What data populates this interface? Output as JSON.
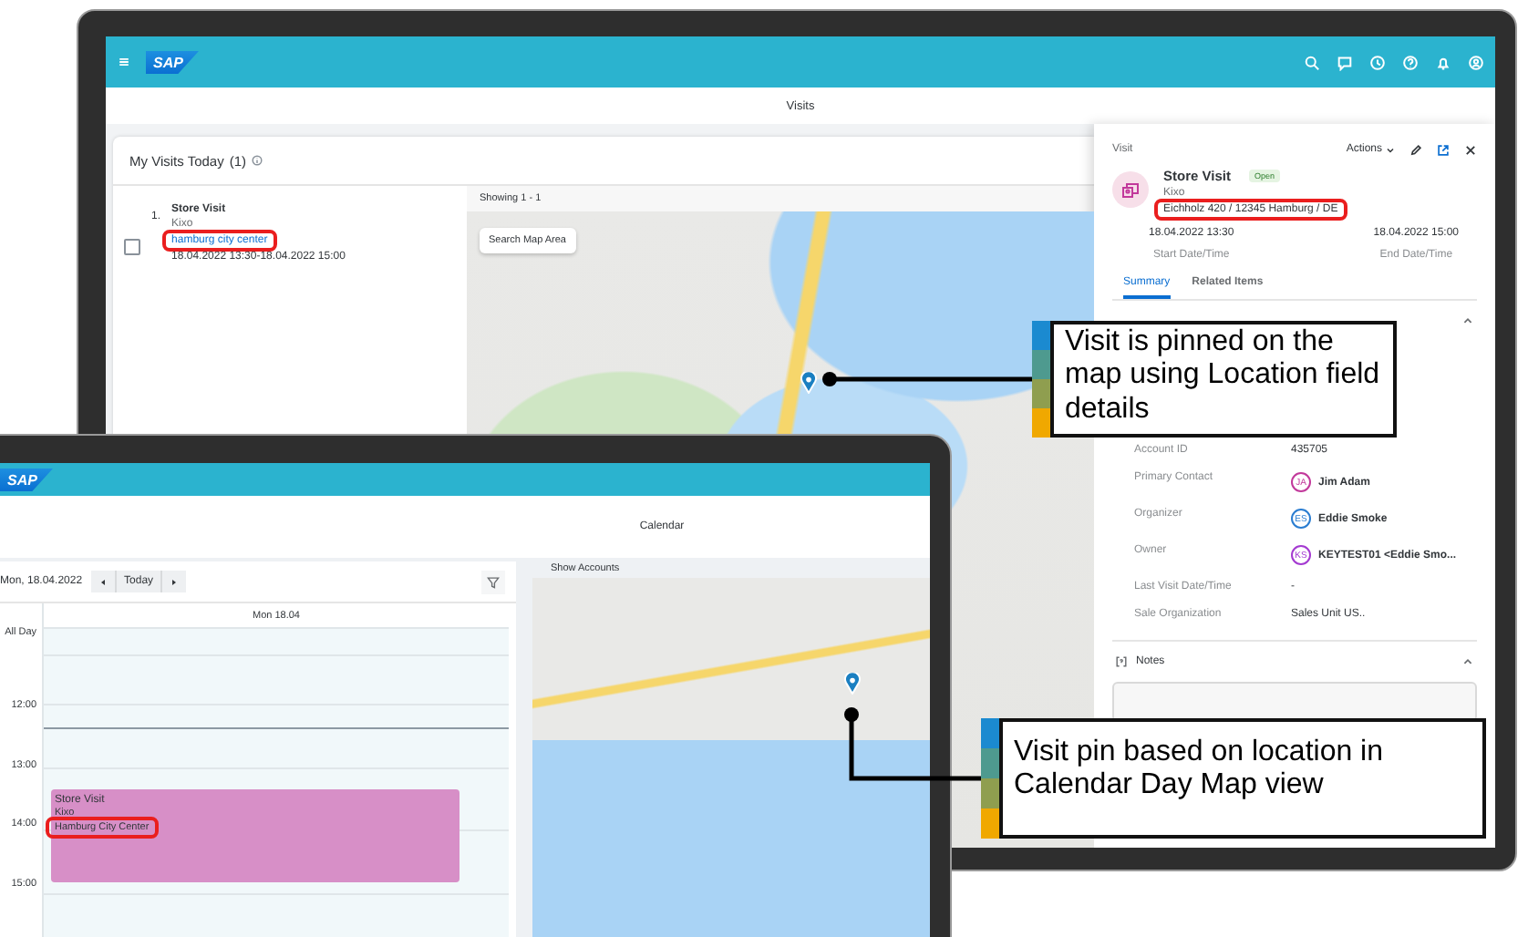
{
  "laptop": {
    "shell": {
      "logo": "SAP"
    },
    "page_title": "Visits",
    "list_card": {
      "title": "My Visits Today",
      "count": "(1)",
      "items": [
        {
          "number": "1.",
          "title": "Store Visit",
          "account": "Kixo",
          "location": "hamburg city center",
          "time": "18.04.2022 13:30-18.04.2022 15:00",
          "checked": false,
          "highlighted": true
        }
      ]
    },
    "map": {
      "results": "Showing 1 - 1",
      "search_button": "Search Map Area"
    },
    "detail": {
      "object_type": "Visit",
      "actions": "Actions",
      "title": "Store Visit",
      "status": "Open",
      "account": "Kixo",
      "address": "Eichholz 420 / 12345 Hamburg / DE",
      "address_highlighted": true,
      "dates": [
        {
          "value": "18.04.2022 13:30",
          "label": "Start Date/Time"
        },
        {
          "value": "18.04.2022 15:00",
          "label": "End Date/Time"
        }
      ],
      "tabs": [
        {
          "label": "Summary",
          "selected": true
        },
        {
          "label": "Related Items",
          "selected": false
        }
      ],
      "fields": [
        {
          "label": "Account ID",
          "value": "435705"
        },
        {
          "label": "Primary Contact",
          "initials": "JA",
          "value": "Jim Adam",
          "color": "#c2399b"
        },
        {
          "label": "Organizer",
          "initials": "ES",
          "value": "Eddie Smoke",
          "color": "#2a7dd1"
        },
        {
          "label": "Owner",
          "initials": "KS",
          "value": "KEYTEST01 <Eddie Smo...",
          "color": "#a43ad1"
        },
        {
          "label": "Last Visit Date/Time",
          "value": "-"
        },
        {
          "label": "Sale Organization",
          "value": "Sales Unit US.."
        }
      ],
      "notes": {
        "title": "Notes"
      }
    }
  },
  "tablet": {
    "shell": {
      "logo": "SAP"
    },
    "page_title": "Calendar",
    "calendar": {
      "date": "Mon, 18.04.2022",
      "today_button": "Today",
      "day_header": "Mon 18.04",
      "all_day": "All Day",
      "hours": [
        "12:00",
        "13:00",
        "14:00",
        "15:00"
      ],
      "appointments": [
        {
          "title": "Store Visit",
          "account": "Kixo",
          "location": "Hamburg City Center",
          "color": "#d78fc7",
          "highlighted": true
        }
      ]
    },
    "map": {
      "show_accounts": "Show Accounts"
    }
  },
  "callouts": [
    {
      "text": "Visit is pinned on the map using Location field details"
    },
    {
      "text": "Visit pin based on location in Calendar Day Map view"
    }
  ]
}
